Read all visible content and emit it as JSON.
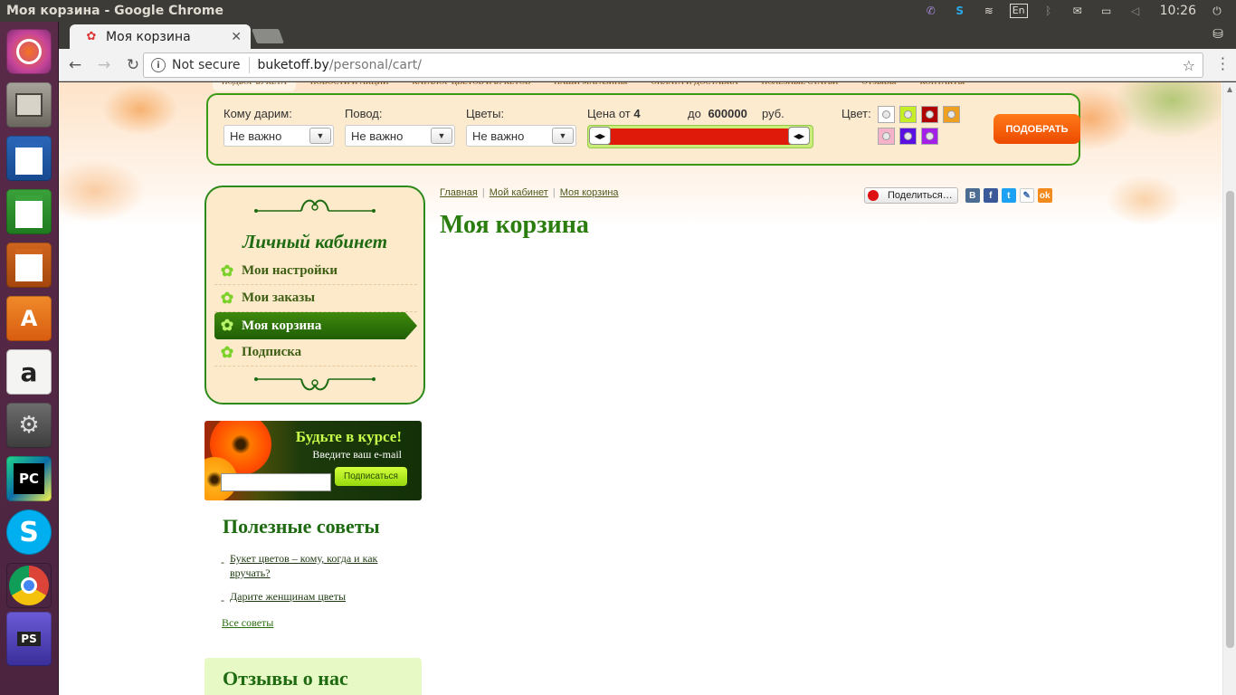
{
  "window": {
    "title": "Моя корзина - Google Chrome"
  },
  "tray": {
    "keyboard": "En",
    "clock": "10:26"
  },
  "launcher": {
    "items": [
      {
        "name": "ubuntu-dash-icon"
      },
      {
        "name": "files-icon"
      },
      {
        "name": "writer-icon"
      },
      {
        "name": "calc-icon"
      },
      {
        "name": "impress-icon"
      },
      {
        "name": "software-center-icon"
      },
      {
        "name": "amazon-icon"
      },
      {
        "name": "system-settings-icon"
      },
      {
        "name": "pycharm-icon",
        "label": "PC"
      },
      {
        "name": "skype-icon",
        "label": "S"
      },
      {
        "name": "chrome-icon"
      },
      {
        "name": "photoshop-icon",
        "label": "PS"
      }
    ]
  },
  "browser": {
    "tab": {
      "title": "Моя корзина"
    },
    "omnibox": {
      "security": "Not secure",
      "host": "buketoff.by",
      "path": "/personal/cart/"
    }
  },
  "site": {
    "nav": [
      "ПОДБОР БУКЕТА",
      "НОВОСТИ И АКЦИИ",
      "КАТАЛОГ ЦВЕТОВ И БУКЕТОВ",
      "НАШИ МАГАЗИНЫ",
      "ОПЛАТА И ДОСТАВКА",
      "ПОЛЕЗНЫЕ СТАТЬИ",
      "ОТЗЫВЫ",
      "КОНТАКТЫ"
    ],
    "filter": {
      "whom_label": "Кому дарим:",
      "whom_value": "Не важно",
      "reason_label": "Повод:",
      "reason_value": "Не важно",
      "flowers_label": "Цветы:",
      "flowers_value": "Не важно",
      "price_from_label": "Цена от",
      "price_from": "4",
      "price_to_label": "до",
      "price_to": "600000",
      "currency": "руб.",
      "color_label": "Цвет:",
      "colors": [
        "#ffffff",
        "#c6ee24",
        "#b00000",
        "#f0a020",
        "#f4b3c8",
        "#5a10e0",
        "#a420e8"
      ],
      "submit": "ПОДОБРАТЬ"
    },
    "account": {
      "title": "Личный кабинет",
      "items": [
        {
          "label": "Мои настройки",
          "active": false
        },
        {
          "label": "Мои заказы",
          "active": false
        },
        {
          "label": "Моя корзина",
          "active": true
        },
        {
          "label": "Подписка",
          "active": false
        }
      ]
    },
    "subscribe": {
      "title": "Будьте в курсе!",
      "subtitle": "Введите ваш e-mail",
      "email_placeholder": "",
      "button": "Подписаться"
    },
    "tips": {
      "title": "Полезные советы",
      "items": [
        "Букет цветов – кому, когда и как вручать?",
        "Дарите женщинам цветы"
      ],
      "all_link": "Все советы"
    },
    "reviews": {
      "title": "Отзывы о нас"
    },
    "breadcrumbs": [
      "Главная",
      "Мой кабинет",
      "Моя корзина"
    ],
    "page_title": "Моя корзина",
    "share": {
      "label": "Поделиться…",
      "networks": [
        "В",
        "f",
        "t",
        "✎",
        "ok"
      ]
    }
  }
}
